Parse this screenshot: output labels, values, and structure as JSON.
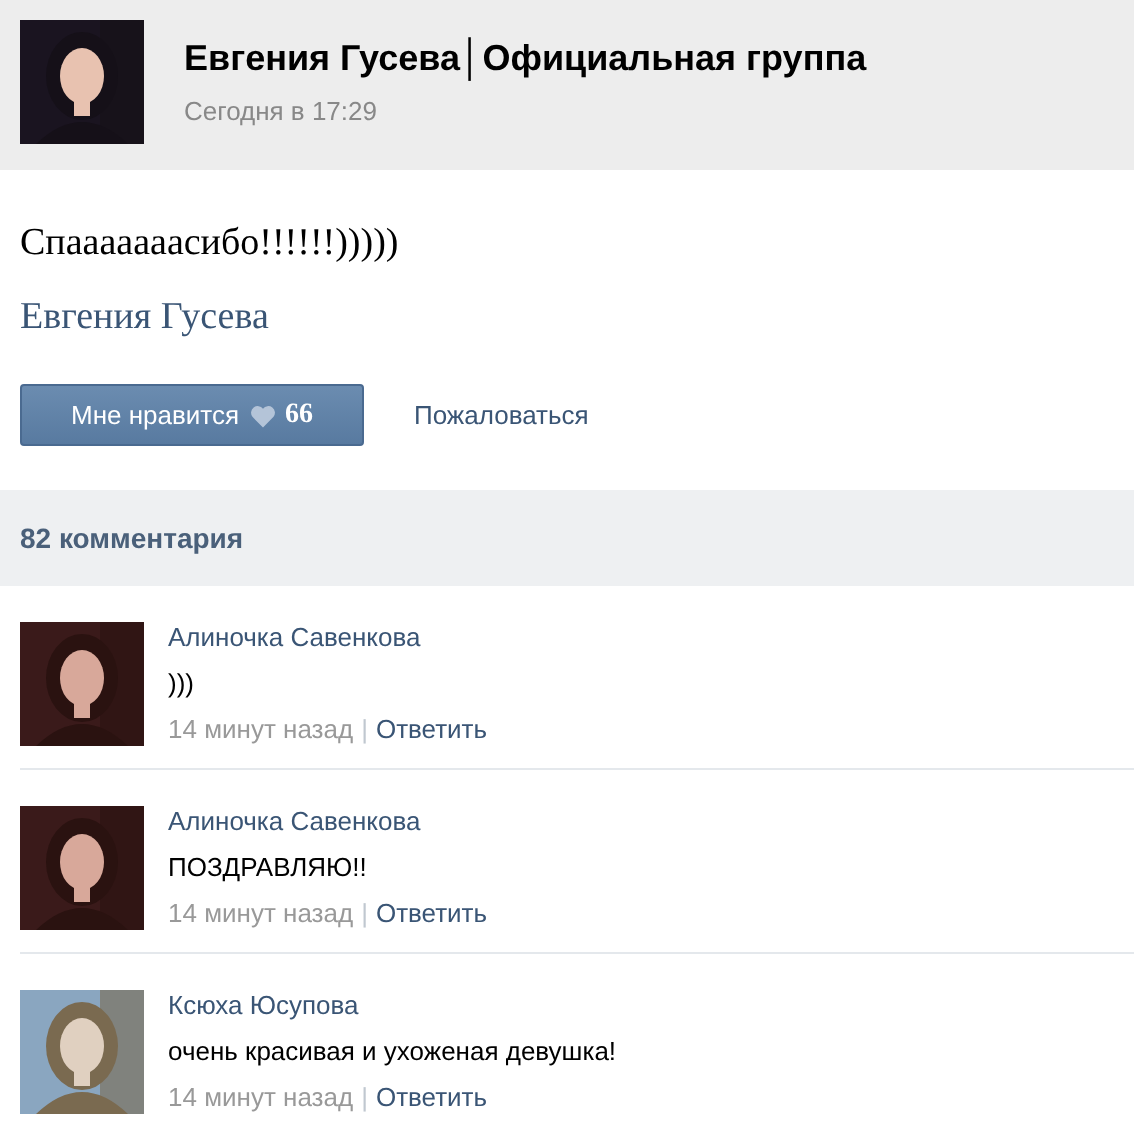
{
  "header": {
    "title": "Евгения Гусева│Официальная группа",
    "time": "Сегодня в 17:29"
  },
  "post": {
    "text": "Спааааааасибо!!!!!!)))))",
    "signature": "Евгения Гусева",
    "like_button": {
      "label": "Мне нравится",
      "count": "66"
    },
    "report_link": "Пожаловаться"
  },
  "comments_header": "82 комментария",
  "comments": [
    {
      "author": "Алиночка Савенкова",
      "text": ")))",
      "time": "14 минут назад",
      "separator": "|",
      "reply": "Ответить"
    },
    {
      "author": "Алиночка Савенкова",
      "text": "ПОЗДРАВЛЯЮ!!",
      "time": "14 минут назад",
      "separator": "|",
      "reply": "Ответить"
    },
    {
      "author": "Ксюха Юсупова",
      "text": "очень красивая и ухоженая девушка!",
      "time": "14 минут назад",
      "separator": "|",
      "reply": "Ответить"
    }
  ]
}
